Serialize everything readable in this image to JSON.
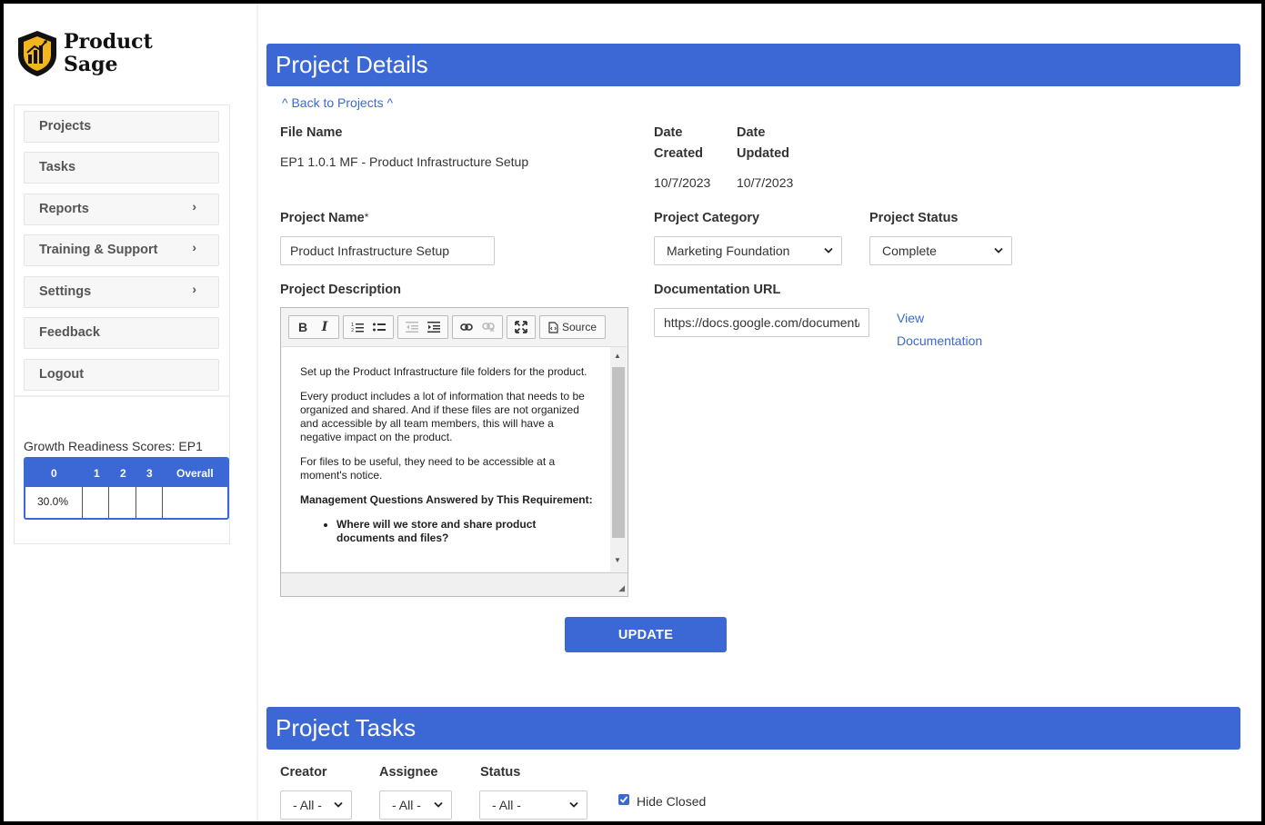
{
  "brand": {
    "name_line1": "Product",
    "name_line2": "Sage"
  },
  "sidebar": {
    "items": [
      {
        "label": "Projects"
      },
      {
        "label": "Tasks"
      },
      {
        "label": "Reports",
        "chevron": "›"
      },
      {
        "label": "Training & Support",
        "chevron": "›"
      },
      {
        "label": "Settings",
        "chevron": "›"
      },
      {
        "label": "Feedback"
      },
      {
        "label": "Logout"
      }
    ],
    "growth": {
      "title": "Growth Readiness Scores: EP1",
      "headers": [
        "0",
        "1",
        "2",
        "3",
        "Overall"
      ],
      "values": [
        "30.0%",
        "",
        "",
        "",
        ""
      ]
    }
  },
  "project_details": {
    "header": "Project Details",
    "back_link": "^ Back to Projects ^",
    "file_name_label": "File Name",
    "file_name": "EP1 1.0.1 MF - Product Infrastructure Setup",
    "date_created_label_1": "Date",
    "date_created_label_2": "Created",
    "date_created": "10/7/2023",
    "date_updated_label_1": "Date",
    "date_updated_label_2": "Updated",
    "date_updated": "10/7/2023",
    "project_name_label": "Project Name",
    "required_mark": "*",
    "project_name": "Product Infrastructure Setup",
    "category_label": "Project Category",
    "category": "Marketing Foundation",
    "status_label": "Project Status",
    "status": "Complete",
    "description_label": "Project Description",
    "doc_url_label": "Documentation URL",
    "doc_url": "https://docs.google.com/document/",
    "view_doc_1": "View",
    "view_doc_2": "Documentation",
    "update_button": "UPDATE"
  },
  "editor": {
    "toolbar": {
      "bold": "B",
      "italic": "I",
      "source": "Source"
    },
    "paragraphs": [
      "Set up the Product Infrastructure file folders for the product.",
      "Every product includes a lot of information that needs to be organized and shared. And if these files are not organized and accessible by all team members, this will have a negative impact on the product.",
      "For files to be useful, they need to be accessible at a moment's notice."
    ],
    "questions_heading": "Management Questions Answered by This Requirement:",
    "questions": [
      "Where will we store and share product documents and files?"
    ]
  },
  "project_tasks": {
    "header": "Project Tasks",
    "creator_label": "Creator",
    "creator_value": "- All -",
    "assignee_label": "Assignee",
    "assignee_value": "- All -",
    "status_label": "Status",
    "status_value": "- All -",
    "hide_closed_label": "Hide Closed",
    "hide_closed_checked": true
  },
  "colors": {
    "accent": "#3b68d4",
    "logo_gold": "#f2b51d"
  }
}
